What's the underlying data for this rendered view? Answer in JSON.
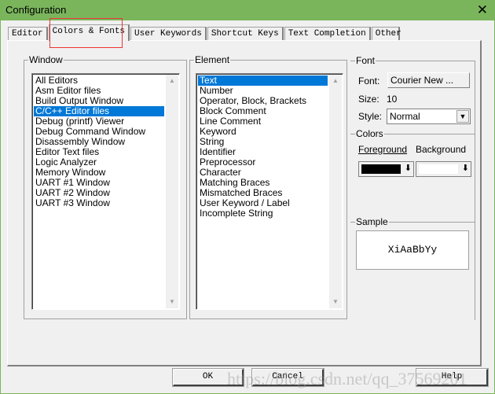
{
  "window": {
    "title": "Configuration"
  },
  "tabs": [
    "Editor",
    "Colors & Fonts",
    "User Keywords",
    "Shortcut Keys",
    "Text Completion",
    "Other"
  ],
  "window_group": {
    "label": "Window",
    "items": [
      "All Editors",
      "Asm Editor files",
      "Build Output Window",
      "C/C++ Editor files",
      "Debug (printf) Viewer",
      "Debug Command Window",
      "Disassembly Window",
      "Editor Text files",
      "Logic Analyzer",
      "Memory Window",
      "UART #1 Window",
      "UART #2 Window",
      "UART #3 Window"
    ],
    "selected": 3
  },
  "element_group": {
    "label": "Element",
    "items": [
      "Text",
      "Number",
      "Operator, Block, Brackets",
      "Block Comment",
      "Line Comment",
      "Keyword",
      "String",
      "Identifier",
      "Preprocessor",
      "Character",
      "Matching Braces",
      "Mismatched Braces",
      "User Keyword / Label",
      "Incomplete String"
    ],
    "selected": 0
  },
  "font_group": {
    "label": "Font",
    "font_label": "Font:",
    "font_value": "Courier New ...",
    "size_label": "Size:",
    "size_value": "10",
    "style_label": "Style:",
    "style_value": "Normal"
  },
  "colors_group": {
    "label": "Colors",
    "foreground_label": "Foreground",
    "background_label": "Background",
    "foreground_color": "#000000",
    "background_color": "#ffffff"
  },
  "sample_group": {
    "label": "Sample",
    "text": "XiAaBbYy"
  },
  "buttons": {
    "ok": "OK",
    "cancel": "Cancel",
    "help": "Help"
  },
  "watermark": "https://blog.csdn.net/qq_37569201",
  "colors": {
    "titlebar": "#7ab55c",
    "selection": "#0078d7"
  }
}
